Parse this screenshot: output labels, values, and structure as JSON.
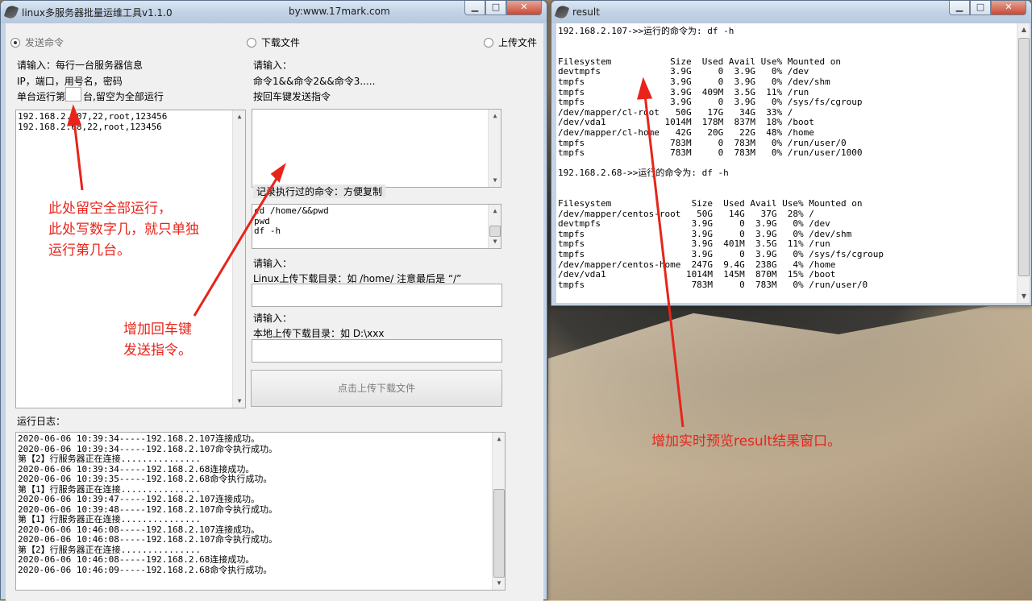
{
  "main_window": {
    "title": "linux多服务器批量运维工具v1.1.0",
    "byline": "by:www.17mark.com",
    "modes": [
      {
        "label": "发送命令",
        "selected": true
      },
      {
        "label": "下载文件",
        "selected": false
      },
      {
        "label": "上传文件",
        "selected": false
      }
    ],
    "server_hint": {
      "line1": "请输入：每行一台服务器信息",
      "line2": "IP，端口，用号名，密码",
      "single_run_prefix": "单台运行第",
      "single_run_suffix": "台,留空为全部运行",
      "single_run_value": ""
    },
    "servers": [
      "192.168.2.107,22,root,123456",
      "192.168.2.68,22,root,123456"
    ],
    "command_hint": {
      "line1": "请输入：",
      "line2": "命令1&&命令2&&命令3.....",
      "line3": "按回车键发送指令"
    },
    "command_input": "",
    "history_label": "记录执行过的命令：方便复制",
    "history": [
      "cd /home/&&pwd",
      "pwd",
      "df -h"
    ],
    "linux_dir": {
      "label1": "请输入：",
      "label2": "Linux上传下载目录：如 /home/ 注意最后是 “/”",
      "value": ""
    },
    "local_dir": {
      "label1": "请输入：",
      "label2": "本地上传下载目录：如 D:\\xxx",
      "value": ""
    },
    "transfer_button": "点击上传下载文件",
    "log_label": "运行日志：",
    "log": [
      "2020-06-06 10:39:34-----192.168.2.107连接成功。",
      "2020-06-06 10:39:34-----192.168.2.107命令执行成功。",
      "第【2】行服务器正在连接...............",
      "2020-06-06 10:39:34-----192.168.2.68连接成功。",
      "2020-06-06 10:39:35-----192.168.2.68命令执行成功。",
      "第【1】行服务器正在连接...............",
      "2020-06-06 10:39:47-----192.168.2.107连接成功。",
      "2020-06-06 10:39:48-----192.168.2.107命令执行成功。",
      "第【1】行服务器正在连接...............",
      "2020-06-06 10:46:08-----192.168.2.107连接成功。",
      "2020-06-06 10:46:08-----192.168.2.107命令执行成功。",
      "第【2】行服务器正在连接...............",
      "2020-06-06 10:46:08-----192.168.2.68连接成功。",
      "2020-06-06 10:46:09-----192.168.2.68命令执行成功。"
    ]
  },
  "window_buttons": {
    "minimize": "▁",
    "maximize": "□",
    "close": "✕"
  },
  "result_window": {
    "title": "result",
    "lines": [
      "192.168.2.107->>运行的命令为: df -h",
      "",
      "",
      "Filesystem           Size  Used Avail Use% Mounted on",
      "devtmpfs             3.9G     0  3.9G   0% /dev",
      "tmpfs                3.9G     0  3.9G   0% /dev/shm",
      "tmpfs                3.9G  409M  3.5G  11% /run",
      "tmpfs                3.9G     0  3.9G   0% /sys/fs/cgroup",
      "/dev/mapper/cl-root   50G   17G   34G  33% /",
      "/dev/vda1           1014M  178M  837M  18% /boot",
      "/dev/mapper/cl-home   42G   20G   22G  48% /home",
      "tmpfs                783M     0  783M   0% /run/user/0",
      "tmpfs                783M     0  783M   0% /run/user/1000",
      "",
      "192.168.2.68->>运行的命令为: df -h",
      "",
      "",
      "Filesystem               Size  Used Avail Use% Mounted on",
      "/dev/mapper/centos-root   50G   14G   37G  28% /",
      "devtmpfs                 3.9G     0  3.9G   0% /dev",
      "tmpfs                    3.9G     0  3.9G   0% /dev/shm",
      "tmpfs                    3.9G  401M  3.5G  11% /run",
      "tmpfs                    3.9G     0  3.9G   0% /sys/fs/cgroup",
      "/dev/mapper/centos-home  247G  9.4G  238G   4% /home",
      "/dev/vda1               1014M  145M  870M  15% /boot",
      "tmpfs                    783M     0  783M   0% /run/user/0"
    ]
  },
  "annotations": {
    "single_run": [
      "此处留空全部运行，",
      "此处写数字几，就只单独",
      "运行第几台。"
    ],
    "enter_key": [
      "增加回车键",
      "发送指令。"
    ],
    "result_window": "增加实时预览result结果窗口。"
  },
  "colors": {
    "annotation": "#e8241a"
  }
}
